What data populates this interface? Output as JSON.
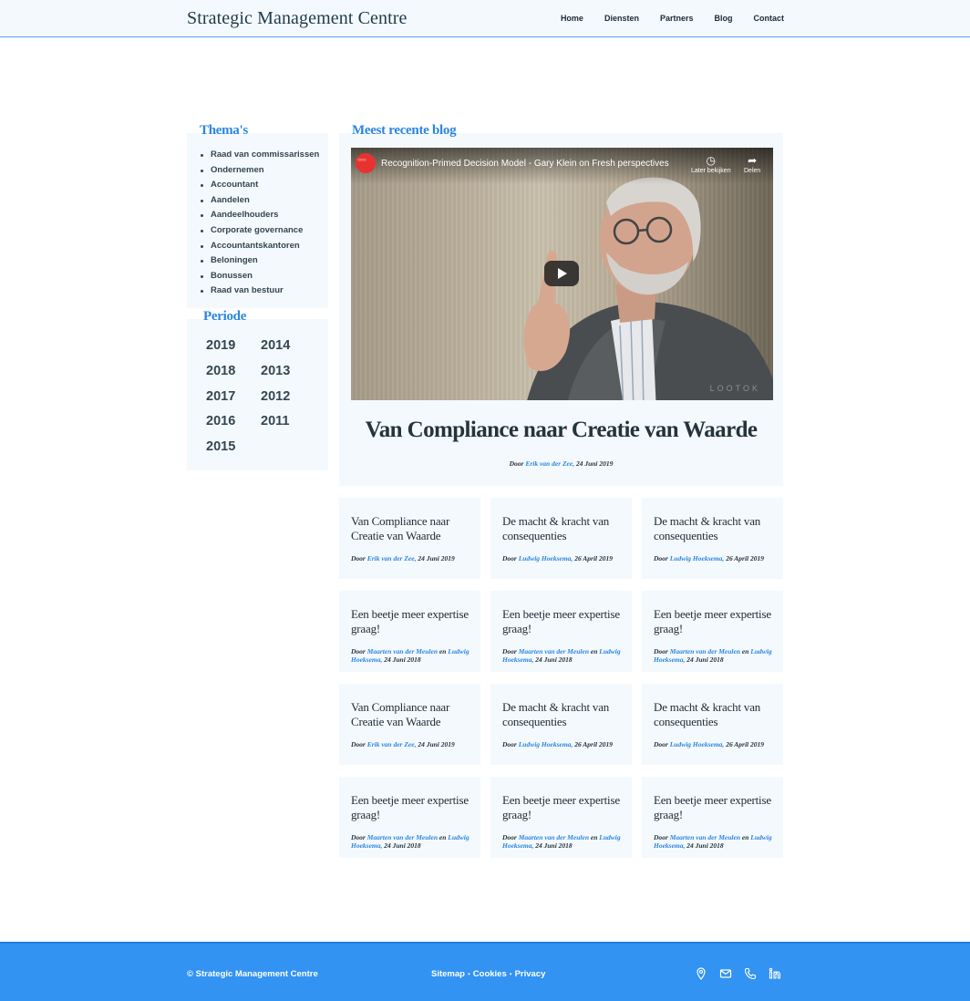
{
  "header": {
    "brand": "Strategic Management Centre",
    "nav": [
      "Home",
      "Diensten",
      "Partners",
      "Blog",
      "Contact"
    ]
  },
  "sidebar": {
    "themas_title": "Thema's",
    "themas": [
      "Raad van commissarissen",
      "Ondernemen",
      "Accountant",
      "Aandelen",
      "Aandeelhouders",
      "Corporate governance",
      "Accountantskantoren",
      "Beloningen",
      "Bonussen",
      "Raad van bestuur"
    ],
    "periode_title": "Periode",
    "years": [
      "2019",
      "2014",
      "2018",
      "2013",
      "2017",
      "2012",
      "2016",
      "2011",
      "2015"
    ]
  },
  "main": {
    "section_title": "Meest recente blog",
    "video": {
      "title": "Recognition-Primed Decision Model - Gary Klein on Fresh perspectives",
      "later_label": "Later bekijken",
      "share_label": "Delen",
      "watermark": "LOOTOK"
    },
    "feature_title": "Van Compliance naar Creatie van Waarde",
    "feature_by": "Door",
    "feature_author": "Erik van der Zee,",
    "feature_date": "24 Juni 2019"
  },
  "cards": [
    {
      "title": "Van Compliance naar Creatie van Waarde",
      "by": "Door",
      "author": "Erik van der Zee,",
      "and": "",
      "author2": "",
      "date": "24 Juni 2019"
    },
    {
      "title": "De macht & kracht van consequenties",
      "by": "Door",
      "author": "Ludwig Hoeksema,",
      "and": "",
      "author2": "",
      "date": "26 April 2019"
    },
    {
      "title": "De macht & kracht van consequenties",
      "by": "Door",
      "author": "Ludwig Hoeksema,",
      "and": "",
      "author2": "",
      "date": "26 April 2019"
    },
    {
      "title": "Een beetje meer expertise graag!",
      "by": "Door",
      "author": "Maarten van der Meulen",
      "and": "en",
      "author2": "Ludwig Hoeksema,",
      "date": "24 Juni 2018"
    },
    {
      "title": "Een beetje meer expertise graag!",
      "by": "Door",
      "author": "Maarten van der Meulen",
      "and": "en",
      "author2": "Ludwig Hoeksema,",
      "date": "24 Juni 2018"
    },
    {
      "title": "Een beetje meer expertise graag!",
      "by": "Door",
      "author": "Maarten van der Meulen",
      "and": "en",
      "author2": "Ludwig Hoeksema,",
      "date": "24 Juni 2018"
    },
    {
      "title": "Van Compliance naar Creatie van Waarde",
      "by": "Door",
      "author": "Erik van der Zee,",
      "and": "",
      "author2": "",
      "date": "24 Juni 2019"
    },
    {
      "title": "De macht & kracht van consequenties",
      "by": "Door",
      "author": "Ludwig Hoeksema,",
      "and": "",
      "author2": "",
      "date": "26 April 2019"
    },
    {
      "title": "De macht & kracht van consequenties",
      "by": "Door",
      "author": "Ludwig Hoeksema,",
      "and": "",
      "author2": "",
      "date": "26 April 2019"
    },
    {
      "title": "Een beetje meer expertise graag!",
      "by": "Door",
      "author": "Maarten van der Meulen",
      "and": "en",
      "author2": "Ludwig Hoeksema,",
      "date": "24 Juni 2018"
    },
    {
      "title": "Een beetje meer expertise graag!",
      "by": "Door",
      "author": "Maarten van der Meulen",
      "and": "en",
      "author2": "Ludwig Hoeksema,",
      "date": "24 Juni 2018"
    },
    {
      "title": "Een beetje meer expertise graag!",
      "by": "Door",
      "author": "Maarten van der Meulen",
      "and": "en",
      "author2": "Ludwig Hoeksema,",
      "date": "24 Juni 2018"
    }
  ],
  "footer": {
    "copyright": "© Strategic Management Centre",
    "links": [
      "Sitemap",
      "Cookies",
      "Privacy"
    ],
    "separator": "•",
    "icons": [
      "location-icon",
      "mail-icon",
      "phone-icon",
      "linkedin-icon"
    ]
  },
  "colors": {
    "accent": "#2a86e0",
    "footer": "#3393f3",
    "panel": "#f4f9fd"
  }
}
